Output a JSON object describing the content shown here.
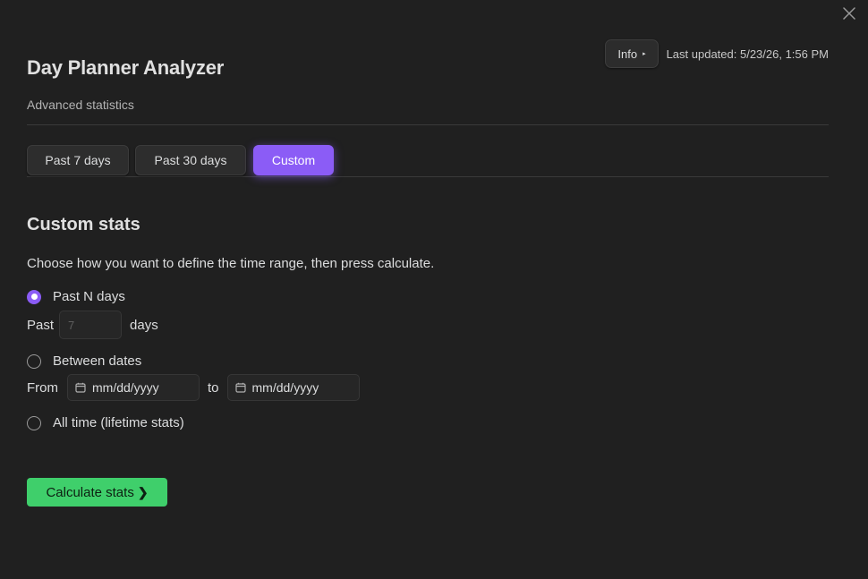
{
  "header": {
    "title": "Day Planner Analyzer",
    "subtitle": "Advanced statistics",
    "info_label": "Info",
    "info_arrow": "▸",
    "last_updated": "Last updated: 5/23/26, 1:56 PM"
  },
  "tabs": [
    {
      "label": "Past 7 days",
      "active": false
    },
    {
      "label": "Past 30 days",
      "active": false
    },
    {
      "label": "Custom",
      "active": true
    }
  ],
  "custom": {
    "section_title": "Custom stats",
    "description": "Choose how you want to define the time range, then press calculate.",
    "options": {
      "past_n": {
        "label": "Past N days",
        "selected": true
      },
      "between": {
        "label": "Between dates",
        "selected": false
      },
      "all_time": {
        "label": "All time (lifetime stats)",
        "selected": false
      }
    },
    "past_prefix": "Past",
    "past_suffix": "days",
    "days_placeholder": "7",
    "from_label": "From",
    "to_label": "to",
    "date_placeholder": "mm/dd/yyyy",
    "calculate_label": "Calculate stats",
    "calculate_chevron": "❯"
  },
  "colors": {
    "accent": "#8b5cf6",
    "calculate": "#3fcf6b",
    "background": "#202020"
  },
  "icons": {
    "close": "close-icon",
    "calendar": "calendar-icon",
    "info_arrow": "caret-right-icon",
    "calculate": "chevron-right-icon"
  }
}
